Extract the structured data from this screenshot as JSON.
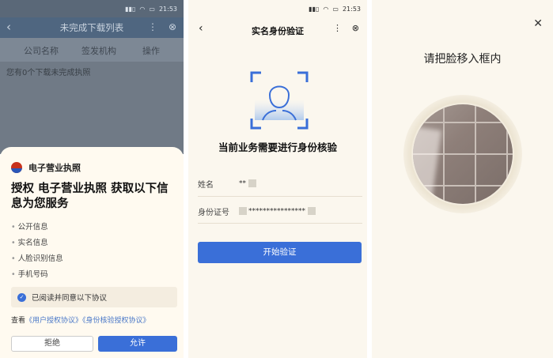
{
  "colors": {
    "primary": "#3a6fd8",
    "sheet_bg": "#fffaf0",
    "page_bg": "#fbf7ee"
  },
  "panel1": {
    "status_time": "21:53",
    "header": {
      "back_icon": "chevron-left-icon",
      "title": "未完成下载列表",
      "more_icon": "more-vertical-icon",
      "close_icon": "close-circle-icon"
    },
    "columns": [
      "公司名称",
      "签发机构",
      "操作"
    ],
    "empty_text": "您有0个下载未完成执照",
    "sheet": {
      "app_name": "电子营业执照",
      "heading": "授权 电子营业执照 获取以下信息为您服务",
      "permissions": [
        "公开信息",
        "实名信息",
        "人脸识别信息",
        "手机号码"
      ],
      "agree_text": "已阅读并同意以下协议",
      "links_prefix": "查看",
      "link_user": "《用户授权协议》",
      "link_identity": "《身份核验授权协议》",
      "refuse_label": "拒绝",
      "allow_label": "允许"
    }
  },
  "panel2": {
    "status_time": "21:53",
    "header": {
      "back_icon": "chevron-left-icon",
      "title": "实名身份验证",
      "more_icon": "more-vertical-icon",
      "close_icon": "close-circle-icon"
    },
    "prompt": "当前业务需要进行身份核验",
    "name_label": "姓名",
    "name_value": "**",
    "id_label": "身份证号",
    "id_value": "****************",
    "start_button": "开始验证"
  },
  "panel3": {
    "close_icon": "close-icon",
    "title": "请把脸移入框内"
  }
}
